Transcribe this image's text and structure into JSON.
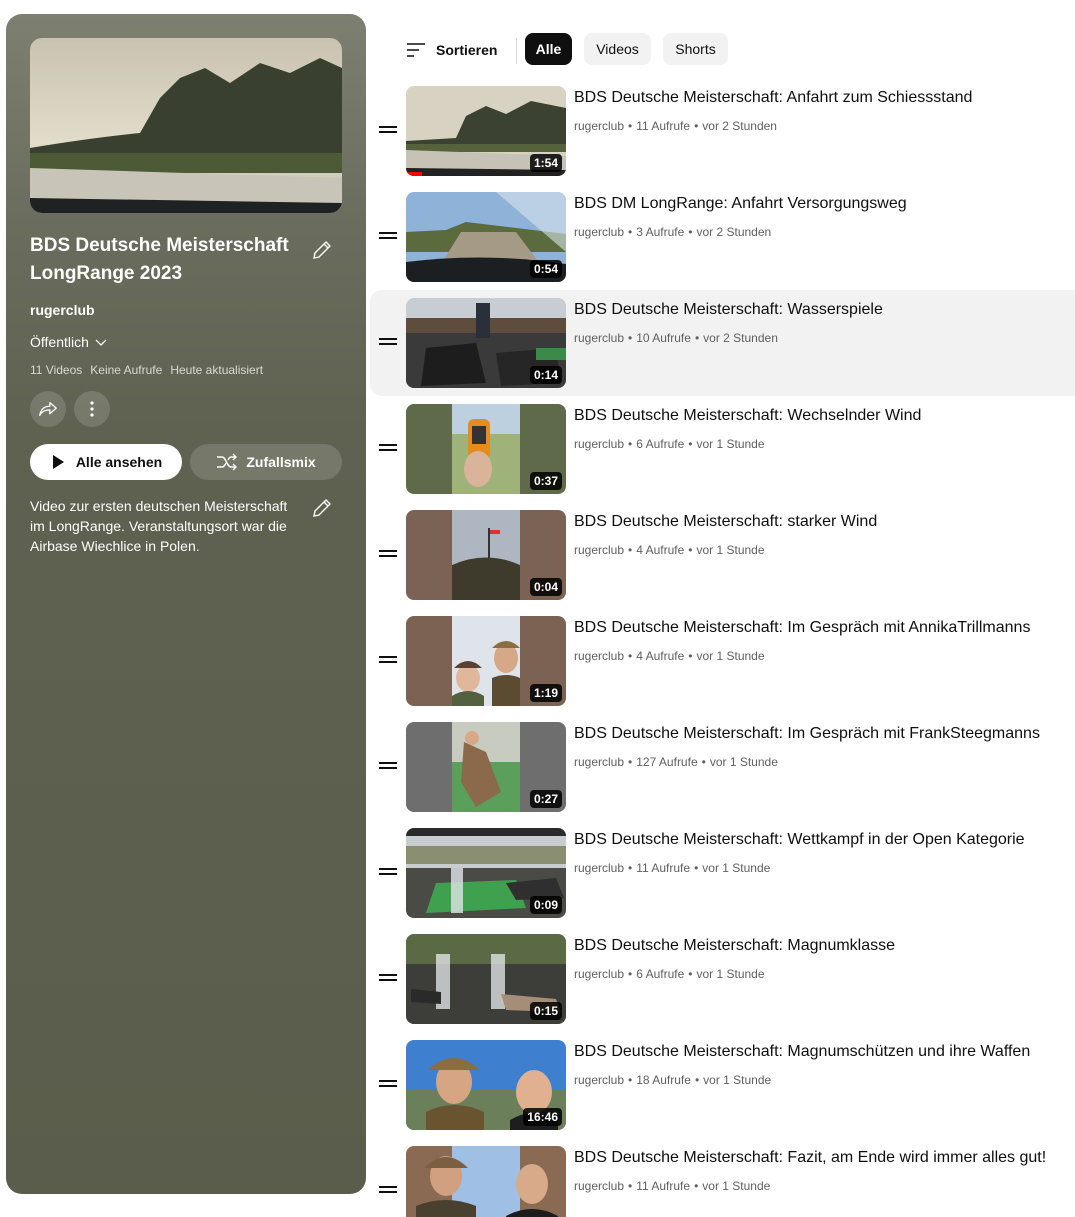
{
  "playlist": {
    "title": "BDS Deutsche Meisterschaft LongRange 2023",
    "owner": "rugerclub",
    "privacy": "Öffentlich",
    "stats": {
      "videos": "11 Videos",
      "views": "Keine Aufrufe",
      "updated": "Heute aktualisiert"
    },
    "play_all_label": "Alle ansehen",
    "shuffle_label": "Zufallsmix",
    "description": "Video zur ersten deutschen Meisterschaft im LongRange. Veranstaltungsort war die Airbase Wiechlice in Polen."
  },
  "toolbar": {
    "sort_label": "Sortieren",
    "chips": [
      "Alle",
      "Videos",
      "Shorts"
    ],
    "active_chip": "Alle"
  },
  "videos": [
    {
      "title": "BDS Deutsche Meisterschaft: Anfahrt zum Schiessstand",
      "channel": "rugerclub",
      "views": "11 Aufrufe",
      "age": "vor 2 Stunden",
      "duration": "1:54"
    },
    {
      "title": "BDS DM LongRange: Anfahrt Versorgungsweg",
      "channel": "rugerclub",
      "views": "3 Aufrufe",
      "age": "vor 2 Stunden",
      "duration": "0:54"
    },
    {
      "title": "BDS Deutsche Meisterschaft: Wasserspiele",
      "channel": "rugerclub",
      "views": "10 Aufrufe",
      "age": "vor 2 Stunden",
      "duration": "0:14"
    },
    {
      "title": "BDS Deutsche Meisterschaft: Wechselnder Wind",
      "channel": "rugerclub",
      "views": "6 Aufrufe",
      "age": "vor 1 Stunde",
      "duration": "0:37"
    },
    {
      "title": "BDS Deutsche Meisterschaft: starker Wind",
      "channel": "rugerclub",
      "views": "4 Aufrufe",
      "age": "vor 1 Stunde",
      "duration": "0:04"
    },
    {
      "title": "BDS Deutsche Meisterschaft: Im Gespräch mit AnnikaTrillmanns",
      "channel": "rugerclub",
      "views": "4 Aufrufe",
      "age": "vor 1 Stunde",
      "duration": "1:19"
    },
    {
      "title": "BDS Deutsche Meisterschaft: Im Gespräch mit FrankSteegmanns",
      "channel": "rugerclub",
      "views": "127 Aufrufe",
      "age": "vor 1 Stunde",
      "duration": "0:27"
    },
    {
      "title": "BDS Deutsche Meisterschaft: Wettkampf in der Open Kategorie",
      "channel": "rugerclub",
      "views": "11 Aufrufe",
      "age": "vor 1 Stunde",
      "duration": "0:09"
    },
    {
      "title": "BDS Deutsche Meisterschaft: Magnumklasse",
      "channel": "rugerclub",
      "views": "6 Aufrufe",
      "age": "vor 1 Stunde",
      "duration": "0:15"
    },
    {
      "title": "BDS Deutsche Meisterschaft: Magnumschützen und ihre Waffen",
      "channel": "rugerclub",
      "views": "18 Aufrufe",
      "age": "vor 1 Stunde",
      "duration": "16:46"
    },
    {
      "title": "BDS Deutsche Meisterschaft: Fazit, am Ende wird immer alles gut!",
      "channel": "rugerclub",
      "views": "11 Aufrufe",
      "age": "vor 1 Stunde",
      "duration": ""
    }
  ]
}
